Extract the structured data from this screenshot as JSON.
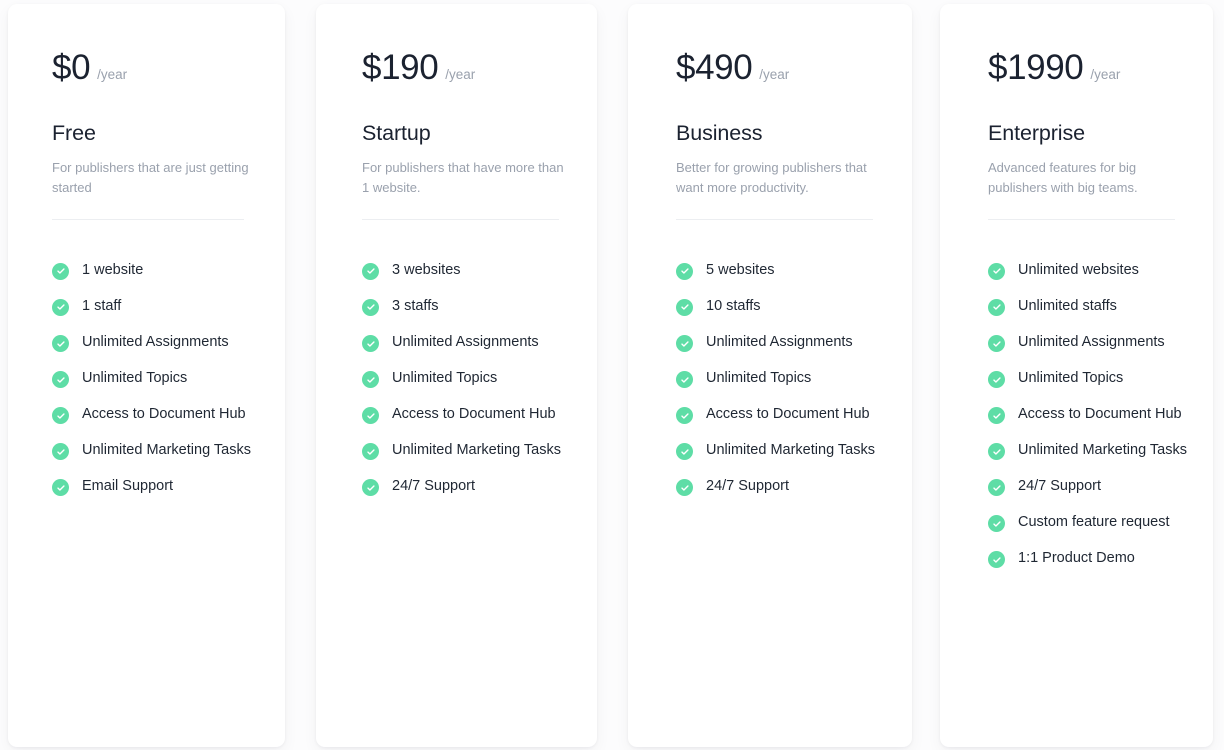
{
  "page": {
    "background_color": "#fcfcfd",
    "card_background": "#ffffff",
    "accent_color": "#5edda6",
    "heading_color": "#1b2230",
    "muted_color": "#9aa1ad",
    "divider_color": "#eceef1"
  },
  "plans": [
    {
      "price": "$0",
      "period": "/year",
      "name": "Free",
      "description": "For publishers that are just getting started",
      "features": [
        "1 website",
        "1 staff",
        "Unlimited Assignments",
        "Unlimited Topics",
        "Access to Document Hub",
        "Unlimited Marketing Tasks",
        "Email Support"
      ]
    },
    {
      "price": "$190",
      "period": "/year",
      "name": "Startup",
      "description": "For publishers that have more than 1 website.",
      "features": [
        "3 websites",
        "3 staffs",
        "Unlimited Assignments",
        "Unlimited Topics",
        "Access to Document Hub",
        "Unlimited Marketing Tasks",
        "24/7 Support"
      ]
    },
    {
      "price": "$490",
      "period": "/year",
      "name": "Business",
      "description": "Better for growing publishers that want more productivity.",
      "features": [
        "5 websites",
        "10 staffs",
        "Unlimited Assignments",
        "Unlimited Topics",
        "Access to Document Hub",
        "Unlimited Marketing Tasks",
        "24/7 Support"
      ]
    },
    {
      "price": "$1990",
      "period": "/year",
      "name": "Enterprise",
      "description": "Advanced features for big publishers with big teams.",
      "features": [
        "Unlimited websites",
        "Unlimited staffs",
        "Unlimited Assignments",
        "Unlimited Topics",
        "Access to Document Hub",
        "Unlimited Marketing Tasks",
        "24/7 Support",
        "Custom feature request",
        "1:1 Product Demo"
      ]
    }
  ],
  "icons": {
    "check": "check-circle-icon"
  }
}
